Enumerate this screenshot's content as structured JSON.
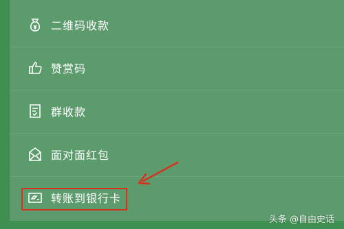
{
  "menu": {
    "items": [
      {
        "label": "二维码收款",
        "icon": "qr-money-bag-icon"
      },
      {
        "label": "赞赏码",
        "icon": "thumbs-up-icon"
      },
      {
        "label": "群收款",
        "icon": "group-receipt-icon"
      },
      {
        "label": "面对面红包",
        "icon": "red-envelope-icon"
      },
      {
        "label": "转账到银行卡",
        "icon": "bank-card-transfer-icon"
      }
    ]
  },
  "annotation": {
    "highlight_color": "#d9301f",
    "arrow_color": "#d9301f"
  },
  "watermark": {
    "text": "头条 @自由史话"
  },
  "colors": {
    "background": "#3f8f50",
    "panel": "#5b9b6c",
    "text": "#ffffff"
  }
}
